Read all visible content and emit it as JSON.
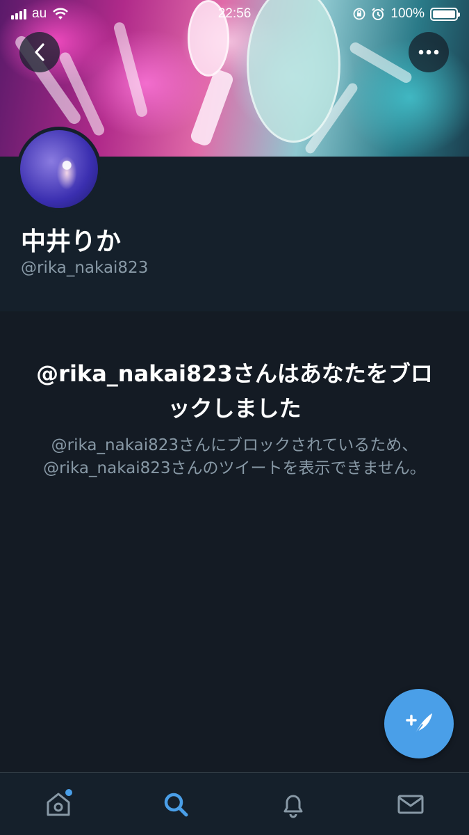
{
  "status_bar": {
    "carrier": "au",
    "time": "22:56",
    "battery_percent": "100%",
    "signal_bars": 4
  },
  "profile": {
    "name": "中井りか",
    "handle": "@rika_nakai823"
  },
  "blocked": {
    "title": "@rika_nakai823さんはあなたをブロックしました",
    "description": "@rika_nakai823さんにブロックされているため、@rika_nakai823さんのツイートを表示できません。"
  },
  "tabs": [
    {
      "name": "home",
      "icon": "home-icon",
      "active": false,
      "has_notification_dot": true
    },
    {
      "name": "search",
      "icon": "search-icon",
      "active": true
    },
    {
      "name": "notifications",
      "icon": "bell-icon",
      "active": false
    },
    {
      "name": "messages",
      "icon": "mail-icon",
      "active": false
    }
  ],
  "colors": {
    "accent": "#4a9fe8",
    "background": "#15202b",
    "secondary_text": "#8899a6"
  }
}
